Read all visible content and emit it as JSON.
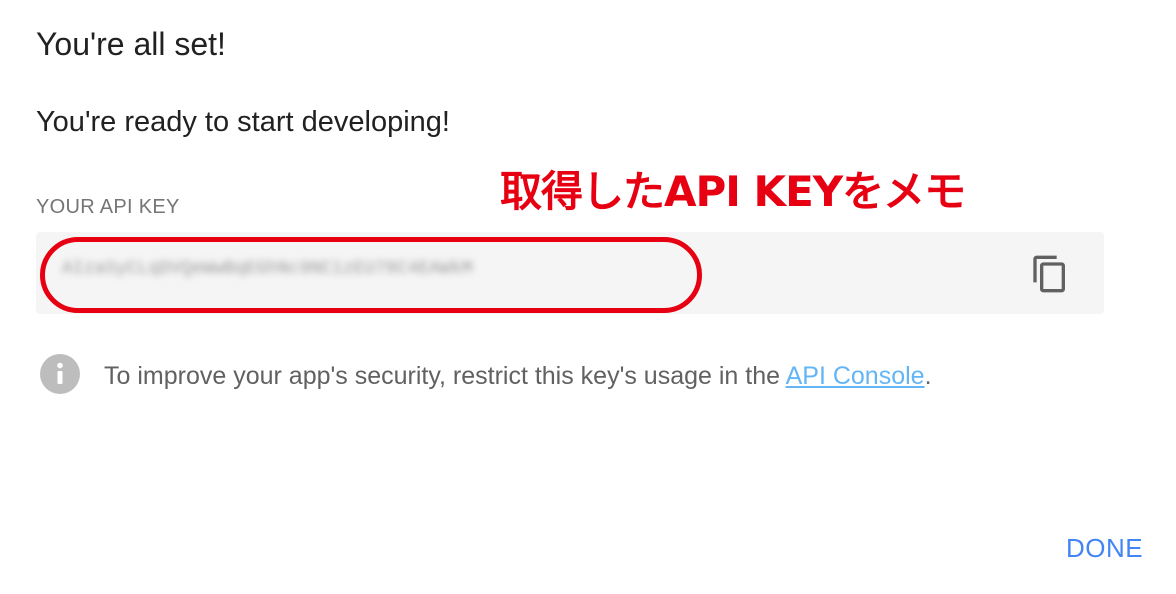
{
  "dialog": {
    "title": "You're all set!",
    "subtitle": "You're ready to start developing!"
  },
  "annotation": {
    "text": "取得したAPI KEYをメモ",
    "color": "#e60012"
  },
  "api_key": {
    "label": "YOUR API KEY",
    "value": "AIzaSyCLqDVQeWwBqEGhNc9NC1zEU78C4EAWkM",
    "copy_icon": "copy-icon"
  },
  "notice": {
    "icon": "info-icon",
    "text_before": "To improve your app's security, restrict this key's usage in the ",
    "link_text": "API Console",
    "text_after": "."
  },
  "actions": {
    "done_label": "DONE"
  },
  "colors": {
    "primary": "#4285f4",
    "link": "#64b5f6",
    "highlight": "#e60012"
  }
}
